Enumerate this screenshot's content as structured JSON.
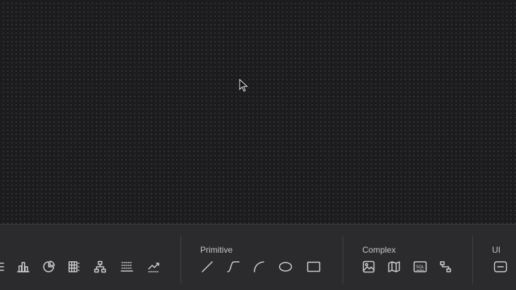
{
  "toolbar": {
    "groups": [
      {
        "label": ""
      },
      {
        "label": "Primitive"
      },
      {
        "label": "Complex"
      },
      {
        "label": "UI"
      }
    ],
    "icons": {
      "list": "list-icon",
      "bar_chart": "bar-chart-icon",
      "pie_chart": "pie-chart-icon",
      "table": "table-icon",
      "hierarchy": "hierarchy-icon",
      "heatmap": "heatmap-icon",
      "line_chart": "line-chart-icon",
      "line": "line-icon",
      "curve": "curve-icon",
      "arc": "arc-icon",
      "ellipse": "ellipse-icon",
      "rectangle": "rectangle-icon",
      "image": "image-icon",
      "map": "map-icon",
      "sql": "sql-icon",
      "flow": "flow-icon",
      "button": "button-icon"
    },
    "sql_icon_text": "SQL"
  },
  "colors": {
    "canvas_bg": "#1c1c1e",
    "grid_dot": "#3a3a3e",
    "toolbar_bg": "#2b2b2d",
    "icon": "#cfcfd2",
    "label": "#c6c6c8"
  }
}
